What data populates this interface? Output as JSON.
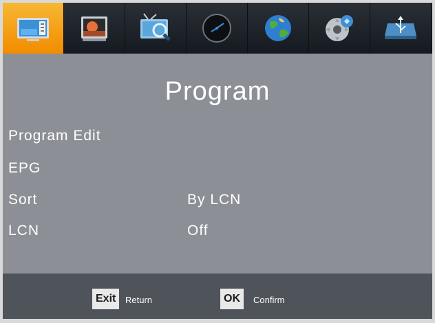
{
  "tabs": [
    {
      "name": "program-icon",
      "active": true
    },
    {
      "name": "picture-icon",
      "active": false
    },
    {
      "name": "channel-search-icon",
      "active": false
    },
    {
      "name": "time-icon",
      "active": false
    },
    {
      "name": "language-globe-icon",
      "active": false
    },
    {
      "name": "system-settings-icon",
      "active": false
    },
    {
      "name": "usb-icon",
      "active": false
    }
  ],
  "menu": {
    "title": "Program",
    "items": [
      {
        "label": "Program Edit",
        "value": ""
      },
      {
        "label": "EPG",
        "value": ""
      },
      {
        "label": "Sort",
        "value": "By LCN"
      },
      {
        "label": "LCN",
        "value": "Off"
      }
    ]
  },
  "footer": {
    "exit_key": "Exit",
    "exit_hint": "Return",
    "ok_key": "OK",
    "ok_hint": "Confirm"
  },
  "colors": {
    "active_tab": "#f7a21b",
    "tab_bar": "#1d2228",
    "content_bg": "#8c9096",
    "footer_bg": "#4f535a"
  }
}
